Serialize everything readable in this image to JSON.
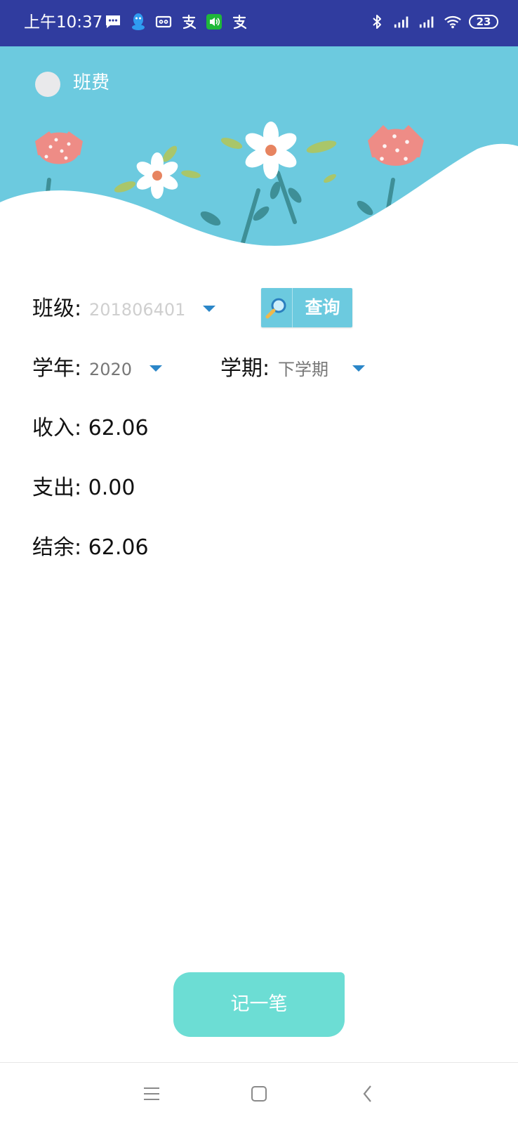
{
  "status_bar": {
    "time": "上午10:37",
    "left_icons": [
      "message-icon",
      "qq-icon",
      "cassette-icon",
      "alipay-icon",
      "speaker-app-icon",
      "alipay-icon"
    ],
    "right_icons": [
      "bluetooth-icon",
      "signal-icon",
      "signal-icon",
      "wifi-icon"
    ],
    "battery": "23",
    "background": "#303c9f"
  },
  "header": {
    "title": "班费",
    "background": "#6ccadf"
  },
  "form": {
    "class_label": "班级:",
    "class_value": "201806401",
    "query_button": "查询",
    "year_label": "学年:",
    "year_value": "2020",
    "term_label": "学期:",
    "term_value": "下学期"
  },
  "summary": {
    "income_label": "收入:",
    "income_value": "62.06",
    "expense_label": "支出:",
    "expense_value": "0.00",
    "balance_label": "结余:",
    "balance_value": "62.06"
  },
  "record_button": "记一笔",
  "nav_bar": {
    "icons": [
      "menu-icon",
      "home-icon",
      "back-icon"
    ]
  },
  "colors": {
    "accent": "#6cddd4",
    "caret": "#2b86c8",
    "placeholder": "#cfcfcf",
    "muted_value": "#777777"
  }
}
